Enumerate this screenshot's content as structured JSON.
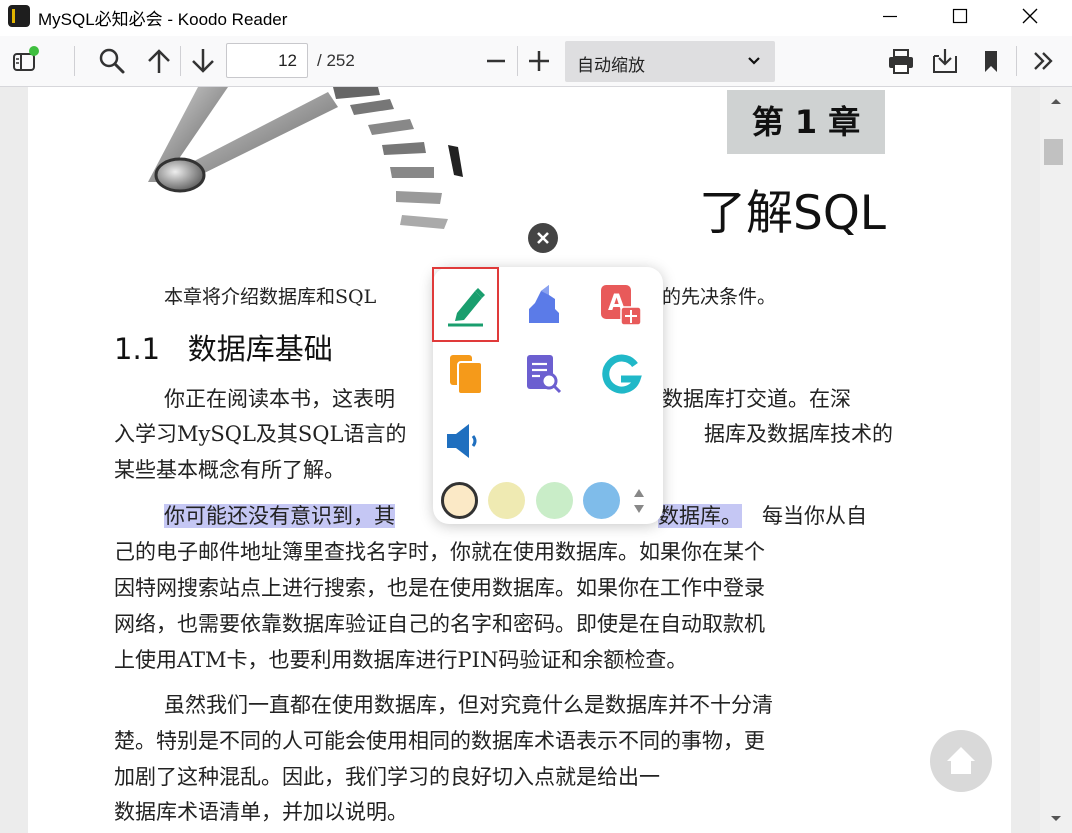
{
  "window": {
    "title": "MySQL必知必会 - Koodo Reader"
  },
  "toolbar": {
    "page_current": "12",
    "page_total": "/ 252",
    "zoom": "自动缩放",
    "accent_indicator_color": "#3fbf3f"
  },
  "document": {
    "chapter_label": "第 1 章",
    "chapter_title": "了解SQL",
    "intro_start": "本章将介绍数据库和SQL",
    "intro_end": "的先决条件。",
    "section_title": "1.1   数据库基础",
    "paragraphs": [
      {
        "line1_start": "你正在阅读本书，这表明",
        "line1_end": "数据库打交道。在深",
        "line2_start": "入学习MySQL及其SQL语言的",
        "line2_end": "据库及数据库技术的",
        "line3": "某些基本概念有所了解。"
      },
      {
        "line1_highlight": "你可能还没有意识到，其",
        "line1_highlight_end": "数据库。",
        "line1_end": "每当你从自",
        "line2": "己的电子邮件地址簿里查找名字时，你就在使用数据库。如果你在某个",
        "line3": "因特网搜索站点上进行搜索，也是在使用数据库。如果你在工作中登录",
        "line4": "网络，也需要依靠数据库验证自己的名字和密码。即使是在自动取款机",
        "line5": "上使用ATM卡，也要利用数据库进行PIN码验证和余额检查。"
      },
      {
        "line1": "虽然我们一直都在使用数据库，但对究竟什么是数据库并不十分清",
        "line2": "楚。特别是不同的人可能会使用相同的数据库术语表示不同的事物，更",
        "line3_start": "加剧了这种混乱。因此，我们学习的良好切入点就是给出一",
        "line4": "数据库术语清单，并加以说明。"
      }
    ],
    "highlight_color": "#c5c7f4"
  },
  "popup": {
    "actions": [
      {
        "icon": "pencil-note-icon",
        "color": "#1a9e6e",
        "selected": true
      },
      {
        "icon": "highlighter-icon",
        "color": "#5b7be8"
      },
      {
        "icon": "translate-icon",
        "color": "#e85a5a"
      },
      {
        "icon": "copy-icon",
        "color": "#f59a1a"
      },
      {
        "icon": "search-in-book-icon",
        "color": "#6c5fd0"
      },
      {
        "icon": "google-search-icon",
        "color": "#20b8c8"
      },
      {
        "icon": "speaker-icon",
        "color": "#1f6fbf"
      }
    ],
    "colors": [
      "#fbe9c6",
      "#efeab2",
      "#c9edc8",
      "#7fbcea"
    ]
  }
}
